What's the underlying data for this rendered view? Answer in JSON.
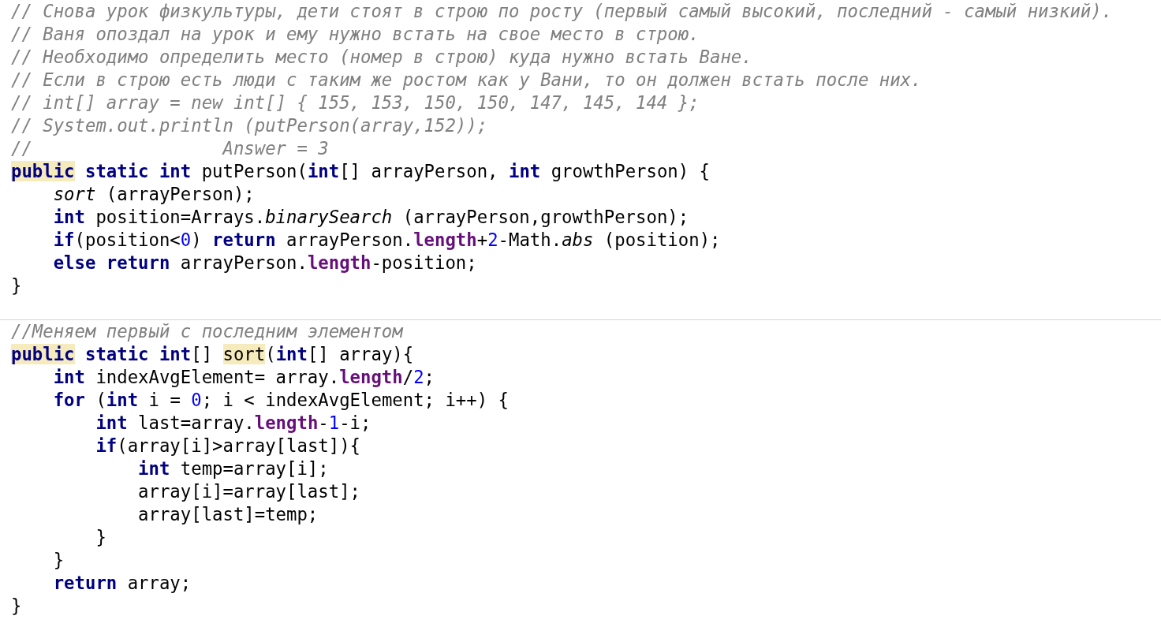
{
  "blocks": [
    {
      "lines": [
        {
          "tokens": [
            {
              "kind": "comment",
              "text": "// Снова урок физкультуры, дети стоят в строю по росту (первый самый высокий, последний - самый низкий)."
            }
          ]
        },
        {
          "tokens": [
            {
              "kind": "comment",
              "text": "// Ваня опоздал на урок и ему нужно встать на свое место в строю."
            }
          ]
        },
        {
          "tokens": [
            {
              "kind": "comment",
              "text": "// Необходимо определить место (номер в строю) куда нужно встать Ване."
            }
          ]
        },
        {
          "tokens": [
            {
              "kind": "comment",
              "text": "// Если в строю есть люди с таким же ростом как у Вани, то он должен встать после них."
            }
          ]
        },
        {
          "tokens": [
            {
              "kind": "comment",
              "text": "// int[] array = new int[] { 155, 153, 150, 150, 147, 145, 144 };"
            }
          ]
        },
        {
          "tokens": [
            {
              "kind": "comment",
              "text": "// System.out.println (putPerson(array,152));"
            }
          ]
        },
        {
          "tokens": [
            {
              "kind": "comment",
              "text": "//                  Answer = 3"
            }
          ]
        },
        {
          "tokens": [
            {
              "kind": "keyword_marked",
              "text": "public"
            },
            {
              "kind": "keyword",
              "text": " static int"
            },
            {
              "kind": "plain",
              "text": " putPerson("
            },
            {
              "kind": "keyword",
              "text": "int"
            },
            {
              "kind": "plain",
              "text": "[] arrayPerson, "
            },
            {
              "kind": "keyword",
              "text": "int"
            },
            {
              "kind": "plain",
              "text": " growthPerson) {"
            }
          ]
        },
        {
          "tokens": [
            {
              "kind": "static_call",
              "text": "    sort"
            },
            {
              "kind": "plain",
              "text": " (arrayPerson);"
            }
          ]
        },
        {
          "tokens": [
            {
              "kind": "keyword",
              "text": "    int"
            },
            {
              "kind": "plain",
              "text": " position=Arrays."
            },
            {
              "kind": "static_call",
              "text": "binarySearch"
            },
            {
              "kind": "plain",
              "text": " (arrayPerson,growthPerson);"
            }
          ]
        },
        {
          "tokens": [
            {
              "kind": "keyword",
              "text": "    if"
            },
            {
              "kind": "plain",
              "text": "(position<"
            },
            {
              "kind": "number",
              "text": "0"
            },
            {
              "kind": "plain",
              "text": ") "
            },
            {
              "kind": "keyword",
              "text": "return"
            },
            {
              "kind": "plain",
              "text": " arrayPerson."
            },
            {
              "kind": "field",
              "text": "length"
            },
            {
              "kind": "plain",
              "text": "+"
            },
            {
              "kind": "number",
              "text": "2"
            },
            {
              "kind": "plain",
              "text": "-Math."
            },
            {
              "kind": "static_call",
              "text": "abs"
            },
            {
              "kind": "plain",
              "text": " (position);"
            }
          ]
        },
        {
          "tokens": [
            {
              "kind": "keyword",
              "text": "    else return"
            },
            {
              "kind": "plain",
              "text": " arrayPerson."
            },
            {
              "kind": "field",
              "text": "length"
            },
            {
              "kind": "plain",
              "text": "-position;"
            }
          ]
        },
        {
          "tokens": [
            {
              "kind": "plain",
              "text": "}"
            }
          ]
        }
      ]
    },
    {
      "lines": [
        {
          "tokens": [
            {
              "kind": "comment",
              "text": "//Меняем первый с последним элементом"
            }
          ]
        },
        {
          "tokens": [
            {
              "kind": "keyword_marked",
              "text": "public"
            },
            {
              "kind": "keyword",
              "text": " static int"
            },
            {
              "kind": "plain",
              "text": "[] "
            },
            {
              "kind": "plain_marked",
              "text": "sort"
            },
            {
              "kind": "plain",
              "text": "("
            },
            {
              "kind": "keyword",
              "text": "int"
            },
            {
              "kind": "plain",
              "text": "[] array){"
            }
          ]
        },
        {
          "tokens": [
            {
              "kind": "keyword",
              "text": "    int"
            },
            {
              "kind": "plain",
              "text": " indexAvgElement= array."
            },
            {
              "kind": "field",
              "text": "length"
            },
            {
              "kind": "plain",
              "text": "/"
            },
            {
              "kind": "number",
              "text": "2"
            },
            {
              "kind": "plain",
              "text": ";"
            }
          ]
        },
        {
          "tokens": [
            {
              "kind": "keyword",
              "text": "    for"
            },
            {
              "kind": "plain",
              "text": " ("
            },
            {
              "kind": "keyword",
              "text": "int"
            },
            {
              "kind": "plain",
              "text": " i = "
            },
            {
              "kind": "number",
              "text": "0"
            },
            {
              "kind": "plain",
              "text": "; i < indexAvgElement; i++) {"
            }
          ]
        },
        {
          "tokens": [
            {
              "kind": "keyword",
              "text": "        int"
            },
            {
              "kind": "plain",
              "text": " last=array."
            },
            {
              "kind": "field",
              "text": "length"
            },
            {
              "kind": "plain",
              "text": "-"
            },
            {
              "kind": "number",
              "text": "1"
            },
            {
              "kind": "plain",
              "text": "-i;"
            }
          ]
        },
        {
          "tokens": [
            {
              "kind": "keyword",
              "text": "        if"
            },
            {
              "kind": "plain",
              "text": "(array[i]>array[last]){"
            }
          ]
        },
        {
          "tokens": [
            {
              "kind": "keyword",
              "text": "            int"
            },
            {
              "kind": "plain",
              "text": " temp=array[i];"
            }
          ]
        },
        {
          "tokens": [
            {
              "kind": "plain",
              "text": "            array[i]=array[last];"
            }
          ]
        },
        {
          "tokens": [
            {
              "kind": "plain",
              "text": "            array[last]=temp;"
            }
          ]
        },
        {
          "tokens": [
            {
              "kind": "plain",
              "text": "        }"
            }
          ]
        },
        {
          "tokens": [
            {
              "kind": "plain",
              "text": "    }"
            }
          ]
        },
        {
          "tokens": [
            {
              "kind": "keyword",
              "text": "    return"
            },
            {
              "kind": "plain",
              "text": " array;"
            }
          ]
        },
        {
          "tokens": [
            {
              "kind": "plain",
              "text": "}"
            }
          ]
        }
      ]
    }
  ]
}
